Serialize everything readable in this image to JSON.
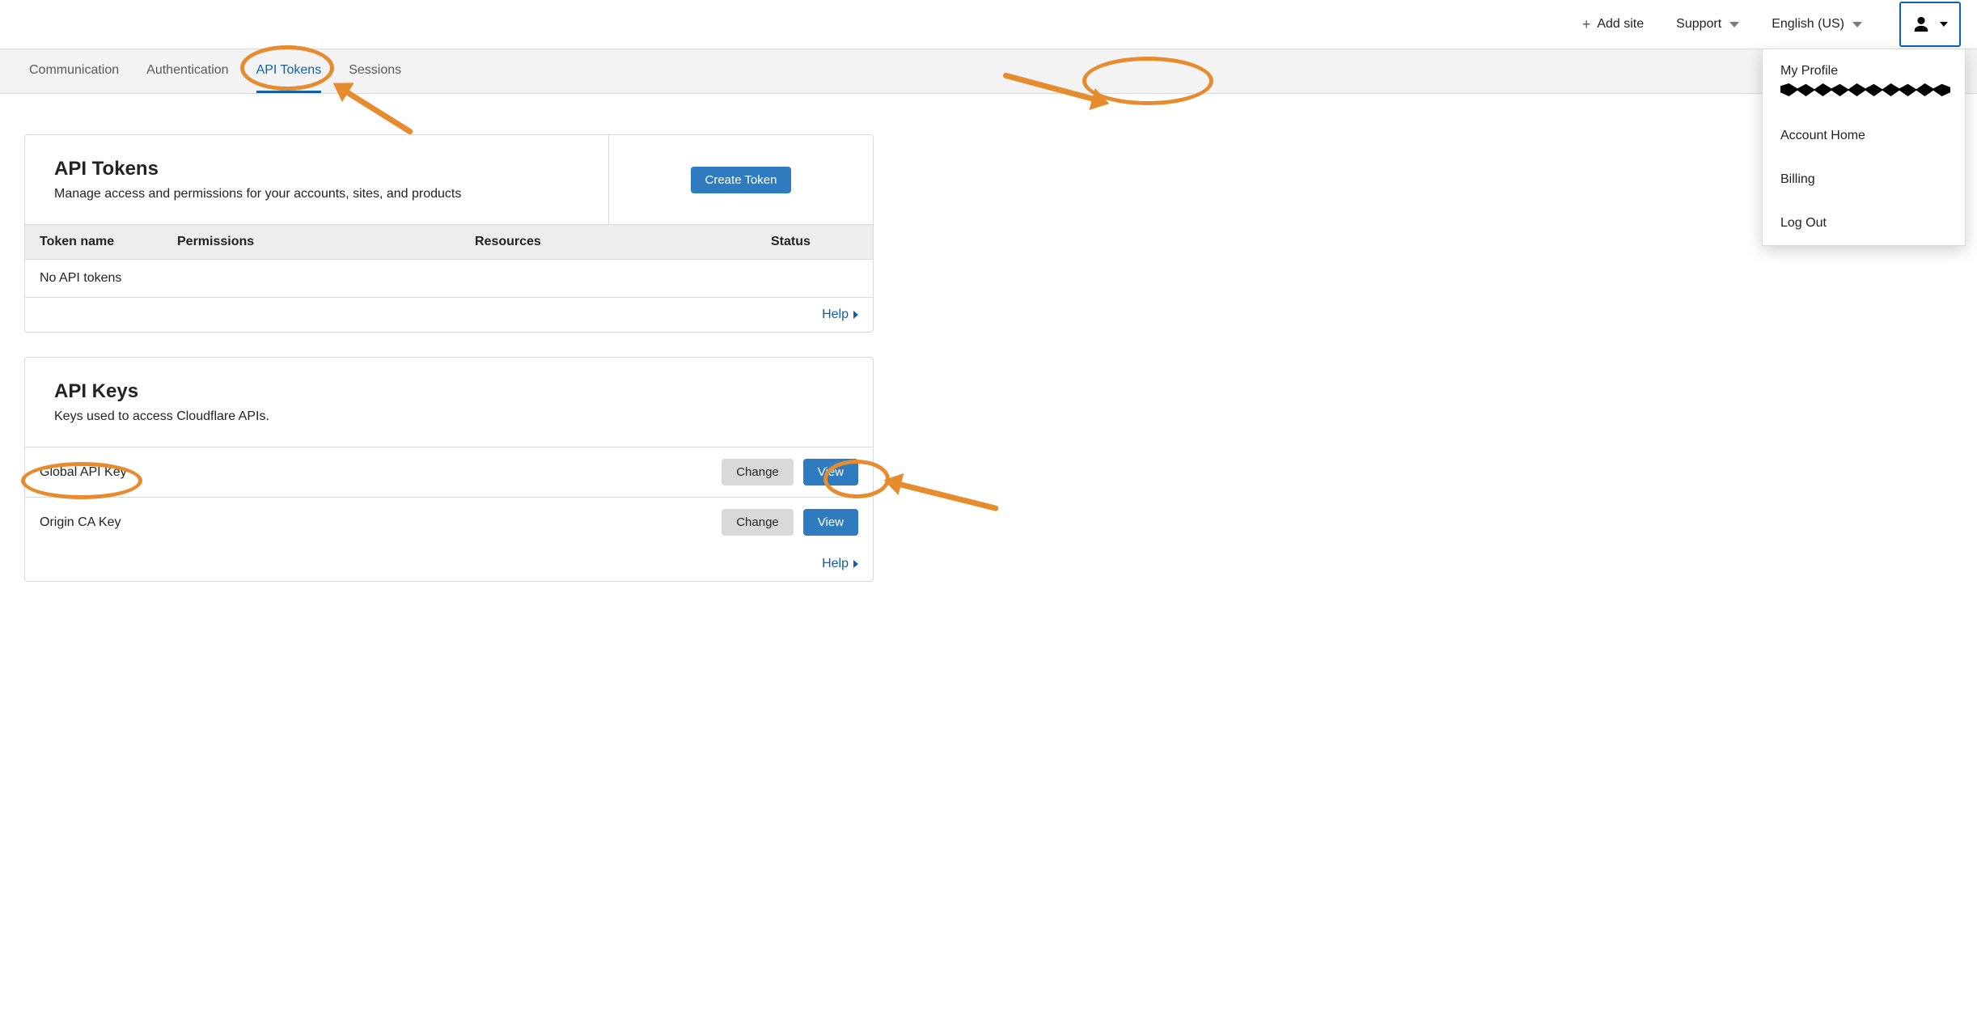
{
  "topbar": {
    "add_site": "Add site",
    "support": "Support",
    "language": "English (US)"
  },
  "user_menu": {
    "my_profile": "My Profile",
    "account_home": "Account Home",
    "billing": "Billing",
    "log_out": "Log Out"
  },
  "tabs": {
    "communication": "Communication",
    "authentication": "Authentication",
    "api_tokens": "API Tokens",
    "sessions": "Sessions"
  },
  "api_tokens_card": {
    "title": "API Tokens",
    "subtitle": "Manage access and permissions for your accounts, sites, and products",
    "create_label": "Create Token",
    "columns": {
      "token_name": "Token name",
      "permissions": "Permissions",
      "resources": "Resources",
      "status": "Status"
    },
    "empty_row": "No API tokens",
    "help": "Help"
  },
  "api_keys_card": {
    "title": "API Keys",
    "subtitle": "Keys used to access Cloudflare APIs.",
    "rows": [
      {
        "name": "Global API Key",
        "change": "Change",
        "view": "View"
      },
      {
        "name": "Origin CA Key",
        "change": "Change",
        "view": "View"
      }
    ],
    "help": "Help"
  }
}
